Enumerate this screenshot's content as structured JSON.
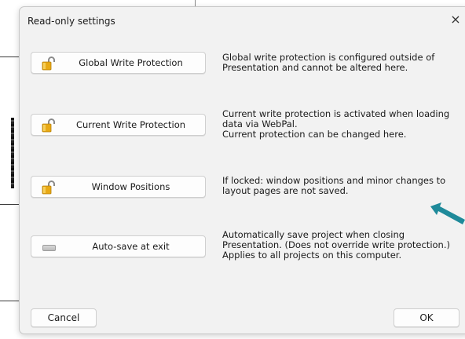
{
  "dialog": {
    "title": "Read-only settings",
    "close_glyph": "×"
  },
  "options": [
    {
      "label": "Global Write Protection",
      "icon": "padlock-icon",
      "description": [
        "Global write protection is configured outside of",
        "Presentation and cannot be altered here."
      ]
    },
    {
      "label": "Current Write Protection",
      "icon": "padlock-icon",
      "description": [
        "Current write protection is activated when loading",
        "data via WebPal.",
        "Current protection can be changed here."
      ]
    },
    {
      "label": "Window Positions",
      "icon": "padlock-icon",
      "description": [
        "If locked: window positions and minor changes to",
        "layout pages are not saved."
      ]
    },
    {
      "label": "Auto-save at exit",
      "icon": "toggle-off-icon",
      "description": [
        "Automatically save project when closing",
        "Presentation. (Does not override write protection.)",
        "Applies to all projects on this computer."
      ]
    }
  ],
  "footer": {
    "cancel_label": "Cancel",
    "ok_label": "OK"
  },
  "colors": {
    "dialog_bg": "#f2f2f2",
    "lock_gold": "#e8a915",
    "annotation_arrow": "#1f8a9a"
  }
}
